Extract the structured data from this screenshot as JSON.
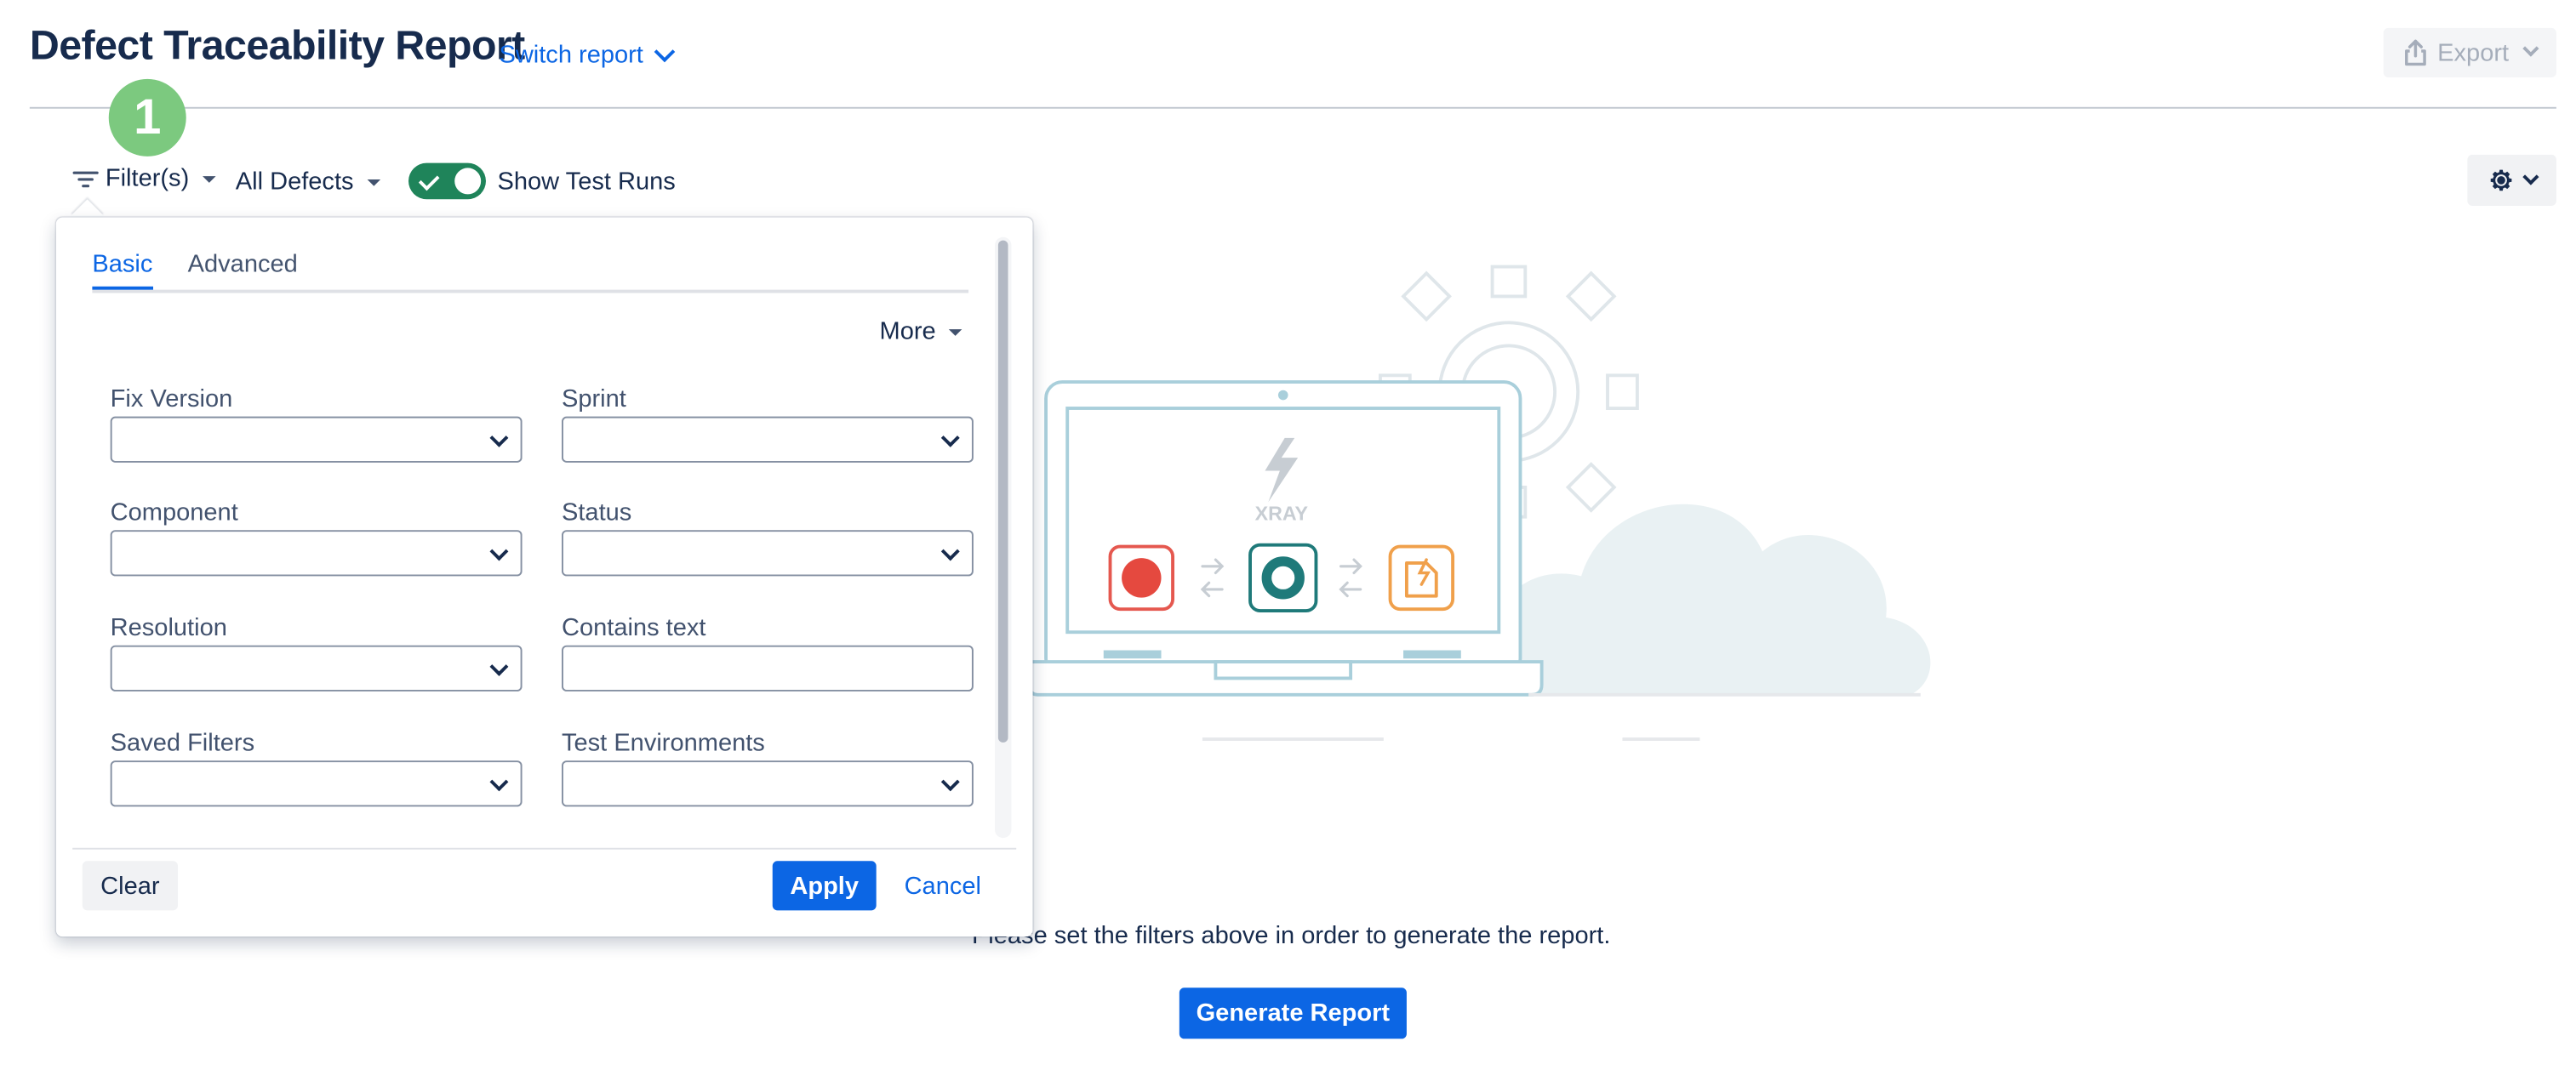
{
  "header": {
    "title": "Defect Traceability Report",
    "switch_report": "Switch report",
    "export_label": "Export"
  },
  "step_badge": "1",
  "toolbar": {
    "filters_label": "Filter(s)",
    "scope_label": "All Defects",
    "show_test_runs_label": "Show Test Runs",
    "show_test_runs_on": true
  },
  "filter_panel": {
    "tabs": [
      {
        "label": "Basic",
        "active": true
      },
      {
        "label": "Advanced",
        "active": false
      }
    ],
    "more_label": "More",
    "fields": [
      {
        "label": "Fix Version",
        "type": "select",
        "value": ""
      },
      {
        "label": "Sprint",
        "type": "select",
        "value": ""
      },
      {
        "label": "Component",
        "type": "select",
        "value": ""
      },
      {
        "label": "Status",
        "type": "select",
        "value": ""
      },
      {
        "label": "Resolution",
        "type": "select",
        "value": ""
      },
      {
        "label": "Contains text",
        "type": "text",
        "value": ""
      },
      {
        "label": "Saved Filters",
        "type": "select",
        "value": ""
      },
      {
        "label": "Test Environments",
        "type": "select",
        "value": ""
      }
    ],
    "clear_label": "Clear",
    "apply_label": "Apply",
    "cancel_label": "Cancel"
  },
  "illustration": {
    "brand_text": "XRAY",
    "icons": [
      "record-icon",
      "arrows-icon",
      "ring-icon",
      "arrows-icon",
      "document-icon"
    ]
  },
  "empty_state": {
    "message": "Please set the filters above in order to generate the report.",
    "generate_label": "Generate Report"
  },
  "colors": {
    "primary": "#0c66e4",
    "toggle_on": "#1f845a",
    "badge": "#7cc97f",
    "text": "#172b4d"
  }
}
